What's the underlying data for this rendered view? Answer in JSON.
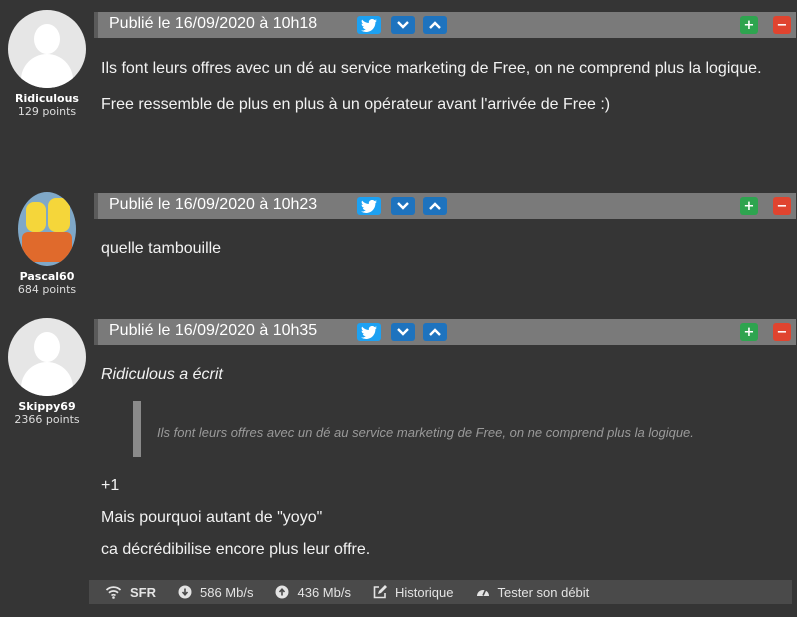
{
  "posts": [
    {
      "user": "Ridiculous",
      "points": "129 points",
      "date": "Publié le 16/09/2020 à 10h18",
      "paragraphs": [
        "Ils font leurs offres avec un dé au service marketing de Free, on ne comprend plus la logique.",
        "Free ressemble de plus en plus à un opérateur avant l'arrivée de Free :)"
      ]
    },
    {
      "user": "Pascal60",
      "points": "684 points",
      "date": "Publié le 16/09/2020 à 10h23",
      "paragraphs": [
        "quelle tambouille"
      ]
    },
    {
      "user": "Skippy69",
      "points": "2366 points",
      "date": "Publié le 16/09/2020 à 10h35",
      "quote_author": "Ridiculous a écrit",
      "quote_text": "Ils font leurs offres avec un dé au service marketing de Free, on ne comprend plus la logique.",
      "paragraphs": [
        "+1",
        "Mais pourquoi autant de \"yoyo\"",
        "ca décrédibilise encore plus leur offre."
      ]
    }
  ],
  "buttons": {
    "plus": "+",
    "minus": "−",
    "down": "⌄",
    "up": "⌃"
  },
  "footer": {
    "operator": "SFR",
    "download": "586 Mb/s",
    "upload": "436 Mb/s",
    "history": "Historique",
    "test": "Tester son débit"
  },
  "colors": {
    "twitter": "#1da1f2",
    "vote_up": "#2ea44f",
    "vote_down": "#e0442f",
    "arrow": "#1e73be"
  }
}
